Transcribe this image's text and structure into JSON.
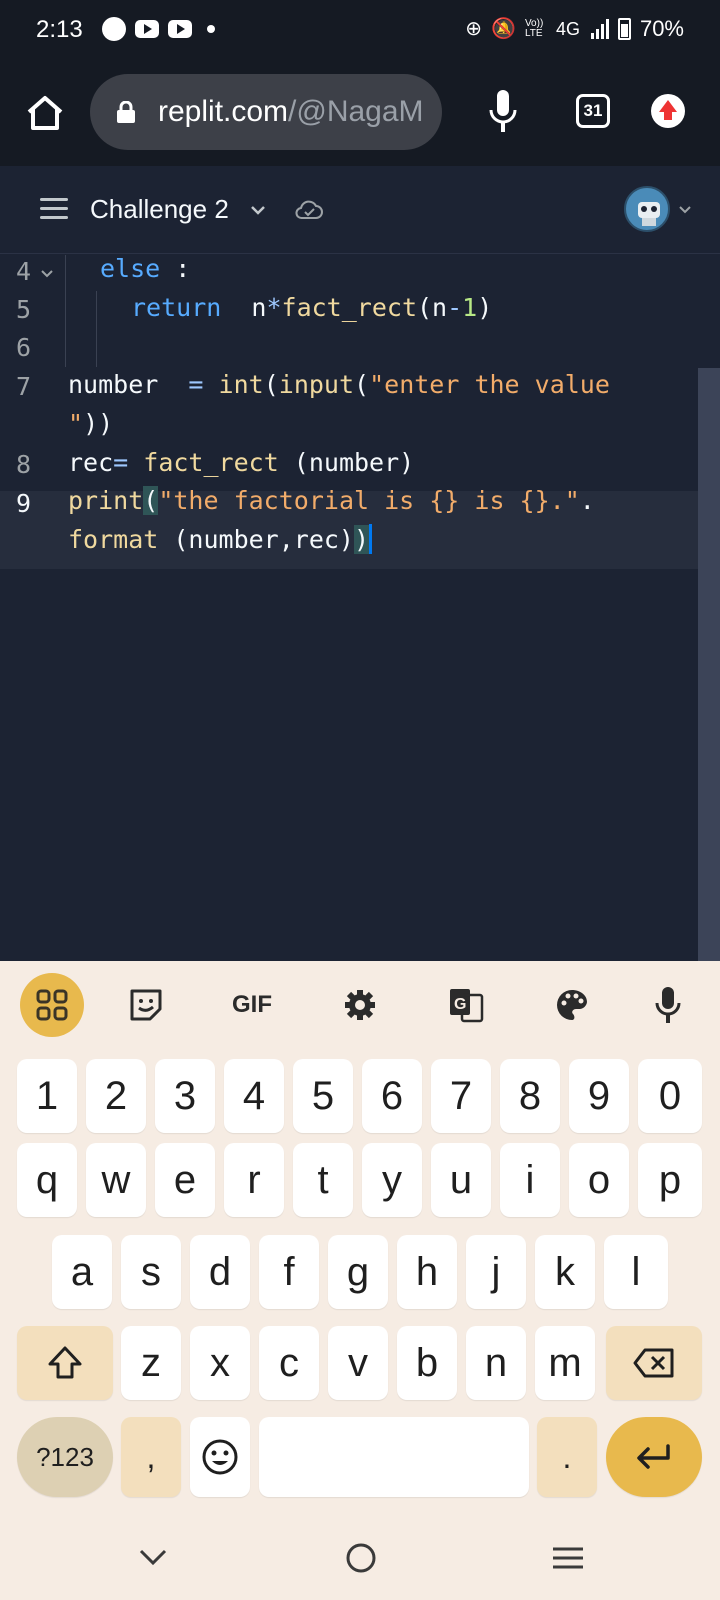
{
  "status_bar": {
    "time": "2:13",
    "network": "4G",
    "volte": "Vo)) LTE",
    "battery": "70%"
  },
  "browser": {
    "url_host": "replit.com",
    "url_path": "/@NagaM",
    "tab_count": "31"
  },
  "replit": {
    "repl_title": "Challenge 2"
  },
  "editor": {
    "line_numbers": [
      "4",
      "5",
      "6",
      "7",
      "8",
      "9"
    ],
    "active_line": "9",
    "colors": {
      "keyword": "#57abff",
      "function": "#f0d99f",
      "string": "#f2ac6a",
      "number": "#b8e986",
      "background": "#1c2333"
    },
    "code": {
      "l4": {
        "kw": "else",
        "rest": " :"
      },
      "l5": {
        "kw": "return",
        "pre": "  n",
        "op": "*",
        "fn": "fact_rect",
        "open": "(n",
        "minus": "-",
        "num": "1",
        "close": ")"
      },
      "l7": {
        "var": "number  ",
        "eq": "=",
        "sp": " ",
        "fn1": "int",
        "p1": "(",
        "fn2": "input",
        "p2": "(",
        "str1": "\"enter the value",
        "str2": "\"",
        "close": "))"
      },
      "l8": {
        "var": "rec",
        "eq": "=",
        "sp": " ",
        "fn": "fact_rect",
        "args": " (number)"
      },
      "l9": {
        "fn": "print",
        "paren": "(",
        "str": "\"the factorial is {} is {}.\"",
        "dot": ".",
        "fn2": "format",
        "args": " (number,rec)",
        "close_paren": ")"
      }
    }
  },
  "keyboard": {
    "toolbar": [
      "apps-grid",
      "sticker",
      "GIF",
      "settings",
      "translate",
      "palette",
      "mic"
    ],
    "gif_label": "GIF",
    "row_numbers": [
      "1",
      "2",
      "3",
      "4",
      "5",
      "6",
      "7",
      "8",
      "9",
      "0"
    ],
    "row_top": [
      "q",
      "w",
      "e",
      "r",
      "t",
      "y",
      "u",
      "i",
      "o",
      "p"
    ],
    "row_mid": [
      "a",
      "s",
      "d",
      "f",
      "g",
      "h",
      "j",
      "k",
      "l"
    ],
    "row_bottom": [
      "z",
      "x",
      "c",
      "v",
      "b",
      "n",
      "m"
    ],
    "symbols_label": "?123",
    "comma": ",",
    "period": "."
  }
}
